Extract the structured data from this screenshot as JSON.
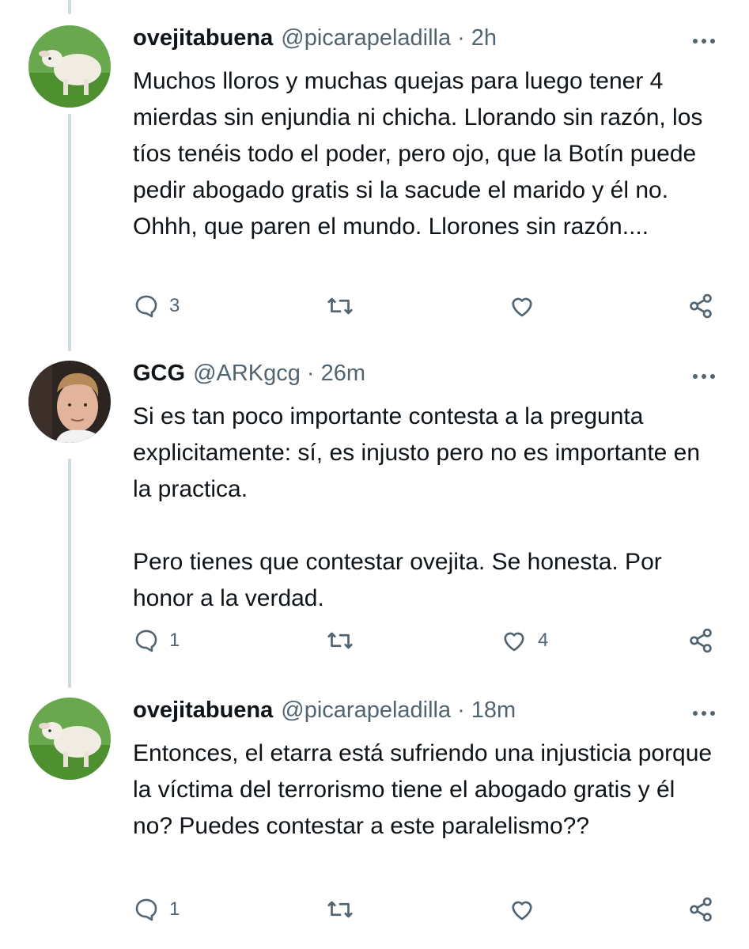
{
  "tweets": [
    {
      "display_name": "ovejitabuena",
      "handle": "@picarapeladilla",
      "separator": "·",
      "time": "2h",
      "text": "Muchos lloros y muchas quejas para luego tener 4 mierdas sin enjundia ni chicha. Llorando sin razón, los tíos tenéis todo el poder, pero ojo, que la Botín puede pedir abogado gratis si la sacude el marido y él no. Ohhh, que paren el mundo. Llorones sin razón....",
      "reply_count": "3",
      "retweet_count": "",
      "like_count": "",
      "avatar": "lamb-avatar"
    },
    {
      "display_name": "GCG",
      "handle": "@ARKgcg",
      "separator": "·",
      "time": "26m",
      "text": "Si es tan poco importante contesta a la pregunta explicitamente: sí, es injusto pero no es importante en la practica.\n\nPero tienes que contestar ovejita. Se honesta. Por honor a la verdad.",
      "reply_count": "1",
      "retweet_count": "",
      "like_count": "4",
      "avatar": "man-portrait-avatar"
    },
    {
      "display_name": "ovejitabuena",
      "handle": "@picarapeladilla",
      "separator": "·",
      "time": "18m",
      "text": "Entonces, el etarra está sufriendo una injusticia porque la víctima del terrorismo tiene el abogado gratis y él no? Puedes contestar a este paralelismo??",
      "reply_count": "1",
      "retweet_count": "",
      "like_count": "",
      "avatar": "lamb-avatar"
    }
  ],
  "icons": {
    "more": "more-horizontal-icon",
    "reply": "reply-bubble-icon",
    "retweet": "retweet-icon",
    "like": "heart-icon",
    "share": "share-icon"
  },
  "colors": {
    "text": "#0f1419",
    "secondary": "#536471",
    "thread_line": "#cfd9de"
  }
}
